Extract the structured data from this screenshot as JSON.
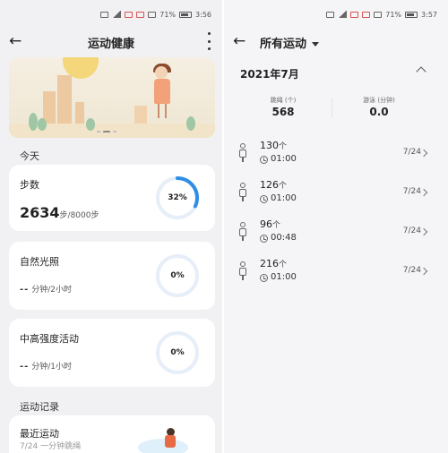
{
  "left": {
    "status": {
      "battery": "71%",
      "time": "3:56"
    },
    "title": "运动健康",
    "today_label": "今天",
    "steps": {
      "name": "步数",
      "value": "2634",
      "unit": "步/8000步",
      "percent_label": "32%",
      "percent": 32
    },
    "daylight": {
      "name": "自然光照",
      "value": "--",
      "unit": "分钟/2小时",
      "percent_label": "0%",
      "percent": 0
    },
    "intensity": {
      "name": "中高强度活动",
      "value": "--",
      "unit": "分钟/1小时",
      "percent_label": "0%",
      "percent": 0
    },
    "records_label": "运动记录",
    "recent": {
      "name": "最近运动",
      "detail": "7/24 一分钟跳绳"
    }
  },
  "right": {
    "status": {
      "battery": "71%",
      "time": "3:57"
    },
    "title": "所有运动",
    "month": "2021年7月",
    "stats": [
      {
        "label": "跳绳 (个)",
        "value": "568"
      },
      {
        "label": "游泳 (分钟)",
        "value": "0.0"
      }
    ],
    "records": [
      {
        "count": "130",
        "unit": "个",
        "duration": "01:00",
        "date": "7/24"
      },
      {
        "count": "126",
        "unit": "个",
        "duration": "01:00",
        "date": "7/24"
      },
      {
        "count": "96",
        "unit": "个",
        "duration": "00:48",
        "date": "7/24"
      },
      {
        "count": "216",
        "unit": "个",
        "duration": "01:00",
        "date": "7/24"
      }
    ]
  },
  "colors": {
    "ring_accent": "#2e8de6",
    "ring_track": "#e6eef8",
    "card": "#ffffff",
    "background": "#f1f1f3"
  },
  "icons": [
    "back-arrow-icon",
    "more-vertical-icon",
    "dropdown-caret-icon",
    "chevron-up-icon",
    "jump-rope-icon",
    "clock-icon",
    "chevron-right-icon"
  ]
}
